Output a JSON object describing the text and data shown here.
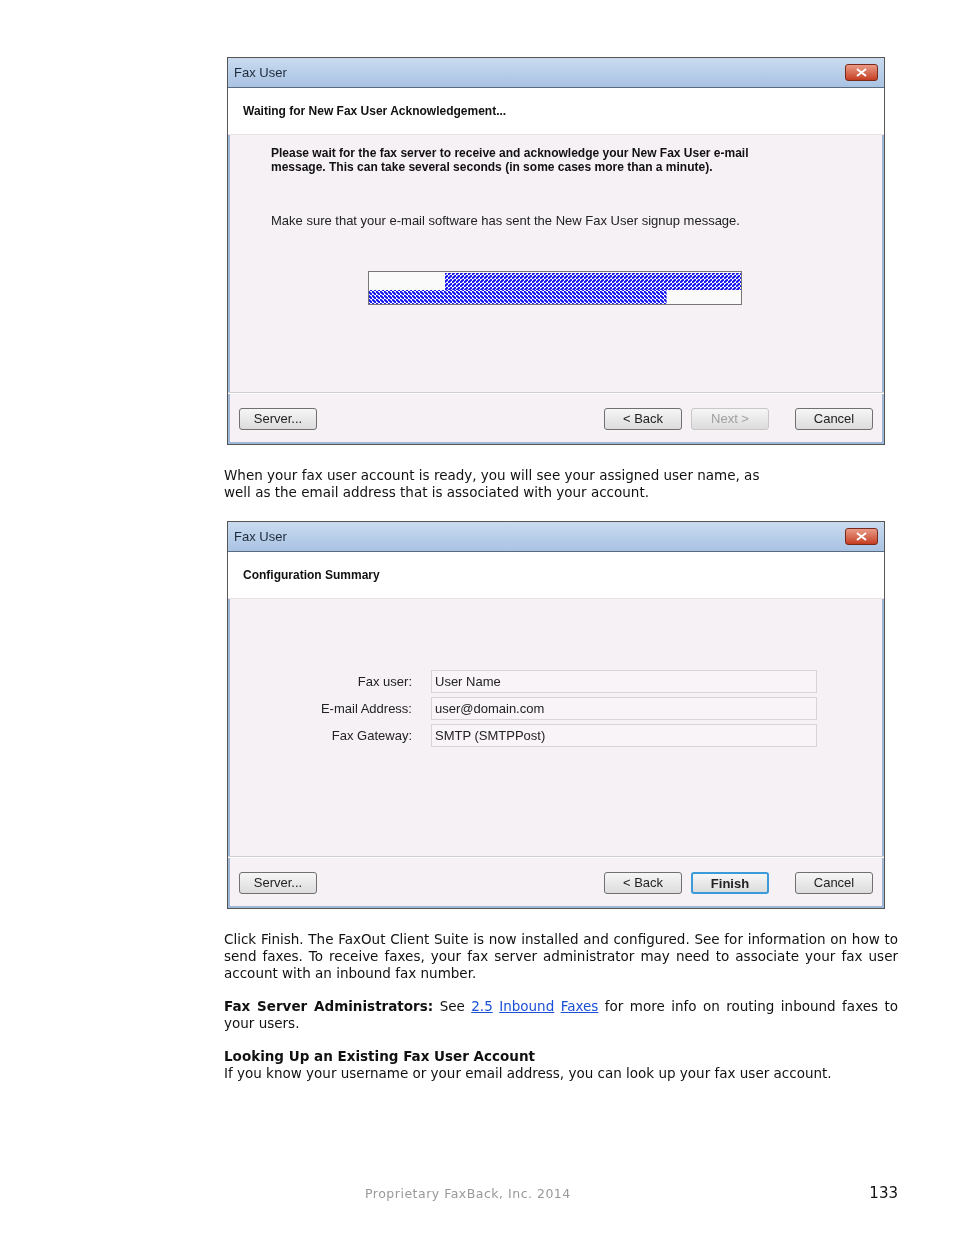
{
  "dialogs": [
    {
      "kind": "progress",
      "title": "Fax User",
      "heading": "Waiting for New Fax User Acknowledgement...",
      "message": "Please wait for the fax server to receive and acknowledge your New Fax User e-mail message.  This can take several seconds (in some cases more than a minute).",
      "note": "Make sure that your e-mail software has sent the New Fax User signup message.",
      "progress": {
        "level": 0.8
      },
      "buttons": [
        {
          "label": "Server...",
          "disabled": false,
          "default": false
        },
        {
          "label": "< Back",
          "disabled": false,
          "default": false
        },
        {
          "label": "Next >",
          "disabled": true,
          "default": false
        },
        {
          "label": "Cancel",
          "disabled": false,
          "default": false
        }
      ]
    },
    {
      "kind": "summary",
      "title": "Fax User",
      "heading": "Configuration Summary",
      "fields": [
        {
          "label": "Fax user:",
          "value": "User Name"
        },
        {
          "label": "E-mail Address:",
          "value": "user@domain.com"
        },
        {
          "label": "Fax Gateway:",
          "value": "SMTP (SMTPPost)"
        }
      ],
      "buttons": [
        {
          "label": "Server...",
          "disabled": false,
          "default": false
        },
        {
          "label": "< Back",
          "disabled": false,
          "default": false
        },
        {
          "label": "Finish",
          "disabled": false,
          "default": true
        },
        {
          "label": "Cancel",
          "disabled": false,
          "default": false
        }
      ]
    }
  ],
  "intro": "When your fax user account is ready, you will see your assigned user name, as well as the email address that is associated with your account.",
  "finish_text": "Click Finish. The FaxOut Client Suite is now installed and configured. See for information on how to send faxes. To receive faxes, your fax server administrator may need to associate your fax user account with an inbound fax number.",
  "admin_note": {
    "lead": "Fax Server Administrators:",
    "before": "See",
    "links": [
      "2.5",
      "Inbound",
      "Faxes"
    ],
    "after": "for more info on routing inbound faxes to your users."
  },
  "section": {
    "heading": "Looking Up an Existing Fax User Account",
    "text": "If you know your username or your email address, you can look up your fax user account."
  },
  "footer": {
    "copyright": "Proprietary FaxBack, Inc. 2014",
    "page_number": "133"
  }
}
